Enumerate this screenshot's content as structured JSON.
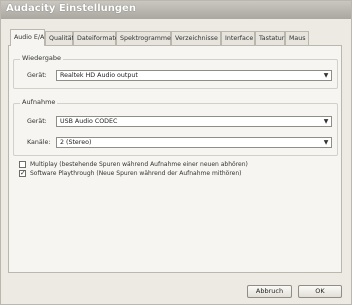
{
  "window": {
    "title": "Audacity Einstellungen"
  },
  "tabs": [
    {
      "label": "Audio E/A",
      "active": true
    },
    {
      "label": "Qualität",
      "active": false
    },
    {
      "label": "Dateiformate",
      "active": false
    },
    {
      "label": "Spektrogramme",
      "active": false
    },
    {
      "label": "Verzeichnisse",
      "active": false
    },
    {
      "label": "Interface",
      "active": false
    },
    {
      "label": "Tastatur",
      "active": false
    },
    {
      "label": "Maus",
      "active": false
    }
  ],
  "playback": {
    "group_label": "Wiedergabe",
    "device_label": "Gerät:",
    "device_value": "Realtek HD Audio output"
  },
  "recording": {
    "group_label": "Aufnahme",
    "device_label": "Gerät:",
    "device_value": "USB Audio CODEC",
    "channels_label": "Kanäle:",
    "channels_value": "2 (Stereo)"
  },
  "options": [
    {
      "label": "Multiplay (bestehende Spuren während Aufnahme einer neuen abhören)",
      "checked": false
    },
    {
      "label": "Software Playthrough (Neue Spuren während der Aufnahme mithören)",
      "checked": true
    }
  ],
  "buttons": {
    "cancel": "Abbruch",
    "ok": "OK"
  }
}
